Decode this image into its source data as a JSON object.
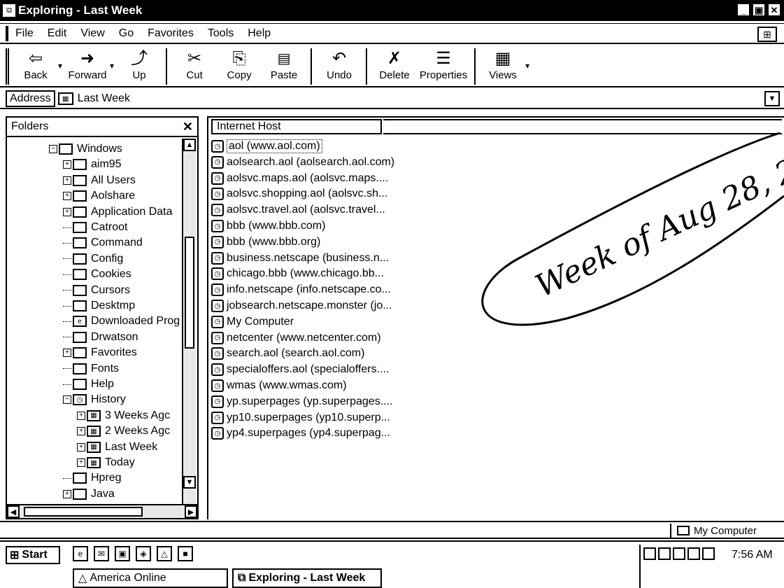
{
  "window": {
    "title": "Exploring - Last Week",
    "buttons": [
      "_",
      "▣",
      "✕"
    ]
  },
  "menu": [
    "File",
    "Edit",
    "View",
    "Go",
    "Favorites",
    "Tools",
    "Help"
  ],
  "toolbar": [
    {
      "label": "Back",
      "icon": "back-arrow-icon",
      "glyph": "⇦"
    },
    {
      "label": "Forward",
      "icon": "forward-arrow-icon",
      "glyph": "➜"
    },
    {
      "label": "Up",
      "icon": "up-folder-icon",
      "glyph": "⤴"
    },
    {
      "label": "Cut",
      "icon": "scissors-icon",
      "glyph": "✂"
    },
    {
      "label": "Copy",
      "icon": "copy-icon",
      "glyph": "⎘"
    },
    {
      "label": "Paste",
      "icon": "paste-icon",
      "glyph": "📋"
    },
    {
      "label": "Undo",
      "icon": "undo-icon",
      "glyph": "↶"
    },
    {
      "label": "Delete",
      "icon": "delete-x-icon",
      "glyph": "✗"
    },
    {
      "label": "Properties",
      "icon": "properties-icon",
      "glyph": "☰"
    },
    {
      "label": "Views",
      "icon": "views-icon",
      "glyph": "▦"
    }
  ],
  "address": {
    "label": "Address",
    "value": "Last Week"
  },
  "folders": {
    "title": "Folders",
    "items": [
      {
        "label": "Windows",
        "level": 0,
        "expander": "−",
        "icon": "open-folder"
      },
      {
        "label": "aim95",
        "level": 1,
        "expander": "+",
        "icon": "folder"
      },
      {
        "label": "All Users",
        "level": 1,
        "expander": "+",
        "icon": "folder"
      },
      {
        "label": "Aolshare",
        "level": 1,
        "expander": "+",
        "icon": "folder"
      },
      {
        "label": "Application Data",
        "level": 1,
        "expander": "+",
        "icon": "folder"
      },
      {
        "label": "Catroot",
        "level": 1,
        "expander": "",
        "icon": "folder"
      },
      {
        "label": "Command",
        "level": 1,
        "expander": "",
        "icon": "folder"
      },
      {
        "label": "Config",
        "level": 1,
        "expander": "",
        "icon": "folder"
      },
      {
        "label": "Cookies",
        "level": 1,
        "expander": "",
        "icon": "folder"
      },
      {
        "label": "Cursors",
        "level": 1,
        "expander": "",
        "icon": "folder"
      },
      {
        "label": "Desktmp",
        "level": 1,
        "expander": "",
        "icon": "folder"
      },
      {
        "label": "Downloaded Prog",
        "level": 1,
        "expander": "",
        "icon": "ie-folder"
      },
      {
        "label": "Drwatson",
        "level": 1,
        "expander": "",
        "icon": "folder"
      },
      {
        "label": "Favorites",
        "level": 1,
        "expander": "+",
        "icon": "folder"
      },
      {
        "label": "Fonts",
        "level": 1,
        "expander": "",
        "icon": "folder"
      },
      {
        "label": "Help",
        "level": 1,
        "expander": "",
        "icon": "folder"
      },
      {
        "label": "History",
        "level": 1,
        "expander": "−",
        "icon": "history-folder"
      },
      {
        "label": "3 Weeks Agc",
        "level": 2,
        "expander": "+",
        "icon": "calendar"
      },
      {
        "label": "2 Weeks Agc",
        "level": 2,
        "expander": "+",
        "icon": "calendar"
      },
      {
        "label": "Last Week",
        "level": 2,
        "expander": "+",
        "icon": "calendar"
      },
      {
        "label": "Today",
        "level": 2,
        "expander": "+",
        "icon": "calendar"
      },
      {
        "label": "Hpreg",
        "level": 1,
        "expander": "",
        "icon": "folder"
      },
      {
        "label": "Java",
        "level": 1,
        "expander": "+",
        "icon": "folder"
      }
    ]
  },
  "list": {
    "column": "Internet Host",
    "rows": [
      "aol (www.aol.com)",
      "aolsearch.aol (aolsearch.aol.com)",
      "aolsvc.maps.aol (aolsvc.maps....",
      "aolsvc.shopping.aol (aolsvc.sh...",
      "aolsvc.travel.aol (aolsvc.travel...",
      "bbb (www.bbb.com)",
      "bbb (www.bbb.org)",
      "business.netscape (business.n...",
      "chicago.bbb (www.chicago.bb...",
      "info.netscape (info.netscape.co...",
      "jobsearch.netscape.monster (jo...",
      "My Computer",
      "netcenter (www.netcenter.com)",
      "search.aol (search.aol.com)",
      "specialoffers.aol (specialoffers....",
      "wmas (www.wmas.com)",
      "yp.superpages (yp.superpages....",
      "yp10.superpages (yp10.superp...",
      "yp4.superpages (yp4.superpag..."
    ]
  },
  "status": {
    "zone": "My Computer"
  },
  "taskbar": {
    "start": "Start",
    "quicklaunch": [
      "ie-icon",
      "outlook-icon",
      "desktop-icon",
      "channels-icon",
      "aol-icon",
      "app-icon"
    ],
    "tasks": [
      "America Online",
      "Exploring - Last Week"
    ],
    "clock": "7:56 AM"
  },
  "annotation": {
    "text": "Week of Aug 28, 2"
  }
}
